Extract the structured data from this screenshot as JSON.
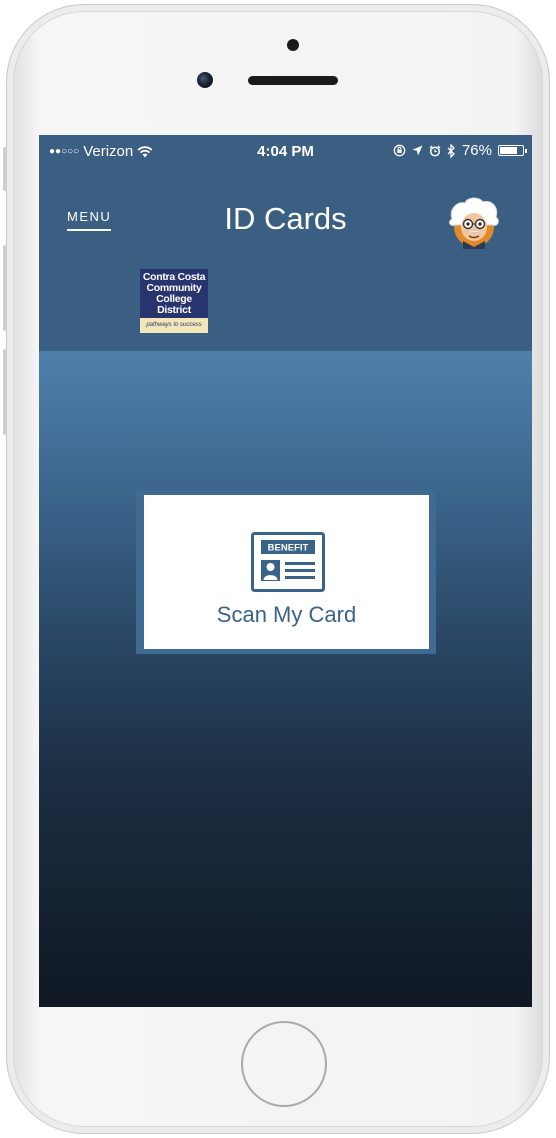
{
  "status_bar": {
    "signal": "●●○○○",
    "carrier": "Verizon",
    "time": "4:04 PM",
    "battery_percent": "76%",
    "battery_level": 0.76
  },
  "header": {
    "menu_label": "MENU",
    "title": "ID Cards",
    "avatar_icon": "einstein-cartoon-avatar"
  },
  "logo": {
    "line1": "Contra Costa",
    "line2": "Community",
    "line3": "College District",
    "tagline": "pathways to success"
  },
  "scan_card": {
    "icon_badge": "BENEFIT",
    "label": "Scan My Card"
  },
  "colors": {
    "header_bg": "#3a5f82",
    "accent": "#3a6389",
    "gradient_top": "#4e80ac",
    "gradient_bottom": "#0f1823"
  }
}
